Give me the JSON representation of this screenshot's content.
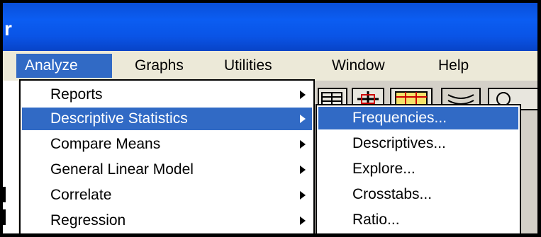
{
  "window": {
    "title": "r"
  },
  "menubar": {
    "items": [
      {
        "label": "Analyze",
        "active": true
      },
      {
        "label": "Graphs"
      },
      {
        "label": "Utilities"
      },
      {
        "label": "Window"
      },
      {
        "label": "Help"
      }
    ]
  },
  "analyze_menu": {
    "items": [
      {
        "label": "Reports",
        "has_submenu": true
      },
      {
        "label": "Descriptive Statistics",
        "has_submenu": true,
        "highlighted": true
      },
      {
        "label": "Compare Means",
        "has_submenu": true
      },
      {
        "label": "General Linear Model",
        "has_submenu": true
      },
      {
        "label": "Correlate",
        "has_submenu": true
      },
      {
        "label": "Regression",
        "has_submenu": true
      }
    ]
  },
  "descriptive_statistics_submenu": {
    "items": [
      {
        "label": "Frequencies...",
        "highlighted": true
      },
      {
        "label": "Descriptives..."
      },
      {
        "label": "Explore..."
      },
      {
        "label": "Crosstabs..."
      },
      {
        "label": "Ratio..."
      }
    ]
  },
  "colors": {
    "highlight": "#316ac5",
    "titlebar": "#0a54e6",
    "menubar": "#ece9d8",
    "toolbar": "#d4d0c8"
  }
}
